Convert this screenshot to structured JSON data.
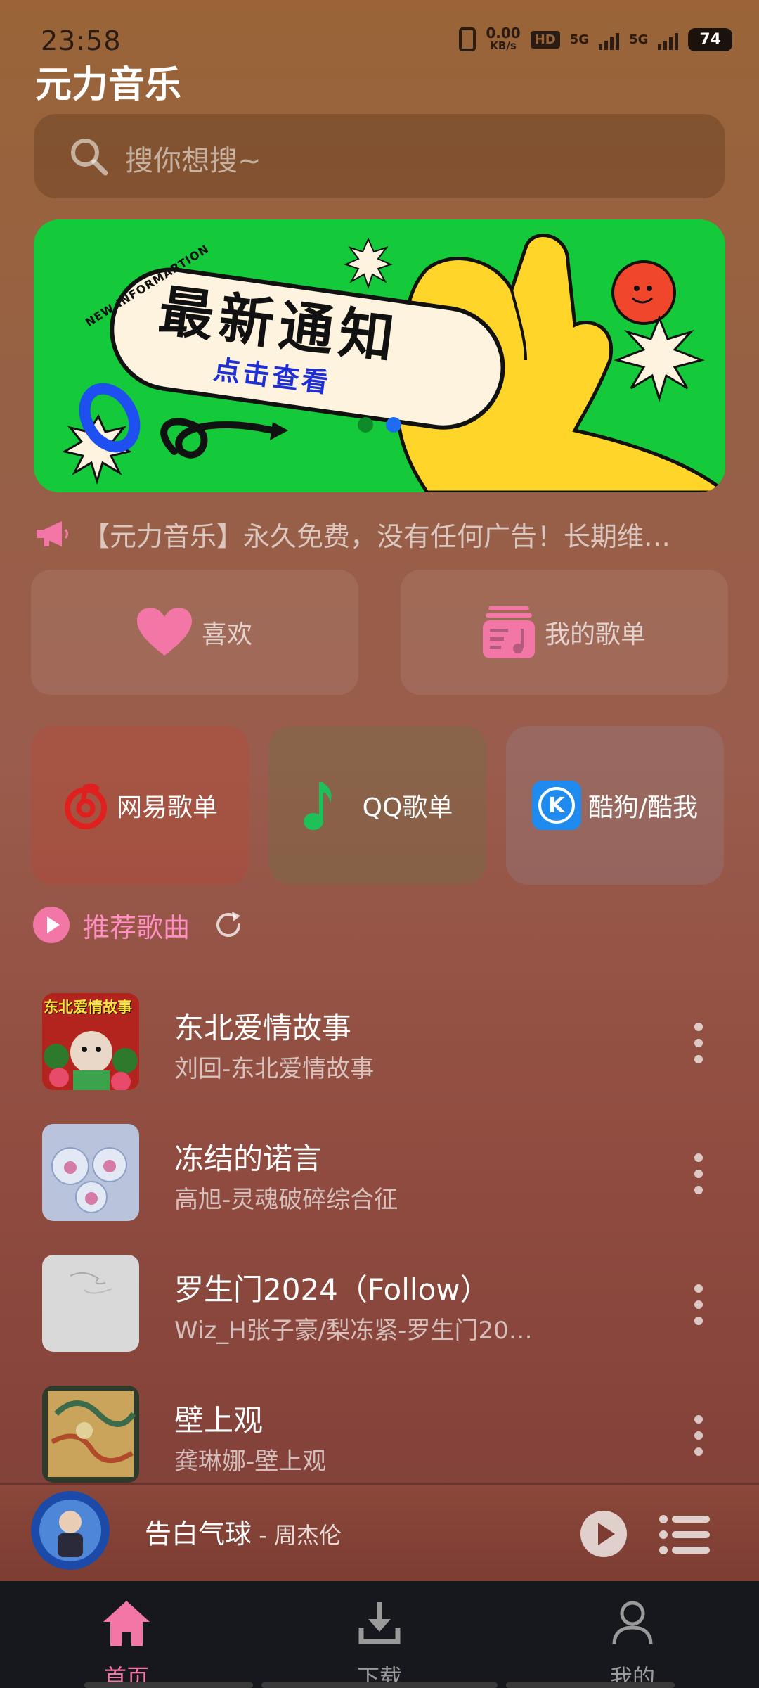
{
  "status": {
    "time": "23:58",
    "net_value": "0.00",
    "net_unit": "KB/s",
    "hd": "HD",
    "sim1": "5G",
    "sim2": "5G",
    "battery": "74"
  },
  "app": {
    "title": "元力音乐"
  },
  "search": {
    "placeholder": "搜你想搜~"
  },
  "banner": {
    "tag": "NEW INFORMARTION",
    "title": "最新通知",
    "subtitle": "点击查看",
    "page_index": 2,
    "page_count": 2
  },
  "ticker": {
    "text": "【元力音乐】永久免费，没有任何广告！长期维…"
  },
  "quick": [
    {
      "label": "喜欢",
      "icon": "heart-icon"
    },
    {
      "label": "我的歌单",
      "icon": "playlist-icon"
    }
  ],
  "platforms": [
    {
      "label": "网易歌单",
      "icon": "netease-icon"
    },
    {
      "label": "QQ歌单",
      "icon": "qq-music-icon"
    },
    {
      "label": "酷狗/酷我",
      "icon": "kugou-icon",
      "icon_letter": "K"
    }
  ],
  "recommend": {
    "label": "推荐歌曲"
  },
  "songs": [
    {
      "title": "东北爱情故事",
      "subtitle": "刘回-东北爱情故事",
      "cover_text": "东北爱情故事"
    },
    {
      "title": "冻结的诺言",
      "subtitle": "高旭-灵魂破碎综合征"
    },
    {
      "title": "罗生门2024（Follow）",
      "subtitle": "Wiz_H张子豪/梨冻紧-罗生门20…"
    },
    {
      "title": "壁上观",
      "subtitle": "龚琳娜-壁上观"
    }
  ],
  "player": {
    "song": "告白气球",
    "separator": " - ",
    "artist": "周杰伦"
  },
  "nav": [
    {
      "label": "首页",
      "icon": "home-icon",
      "active": true
    },
    {
      "label": "下载",
      "icon": "download-icon",
      "active": false
    },
    {
      "label": "我的",
      "icon": "profile-icon",
      "active": false
    }
  ],
  "colors": {
    "accent": "#f277a6",
    "banner": "#14c93a",
    "netease": "#e0201f",
    "qq": "#1fbf5a",
    "kugou": "#1f8bf0"
  }
}
